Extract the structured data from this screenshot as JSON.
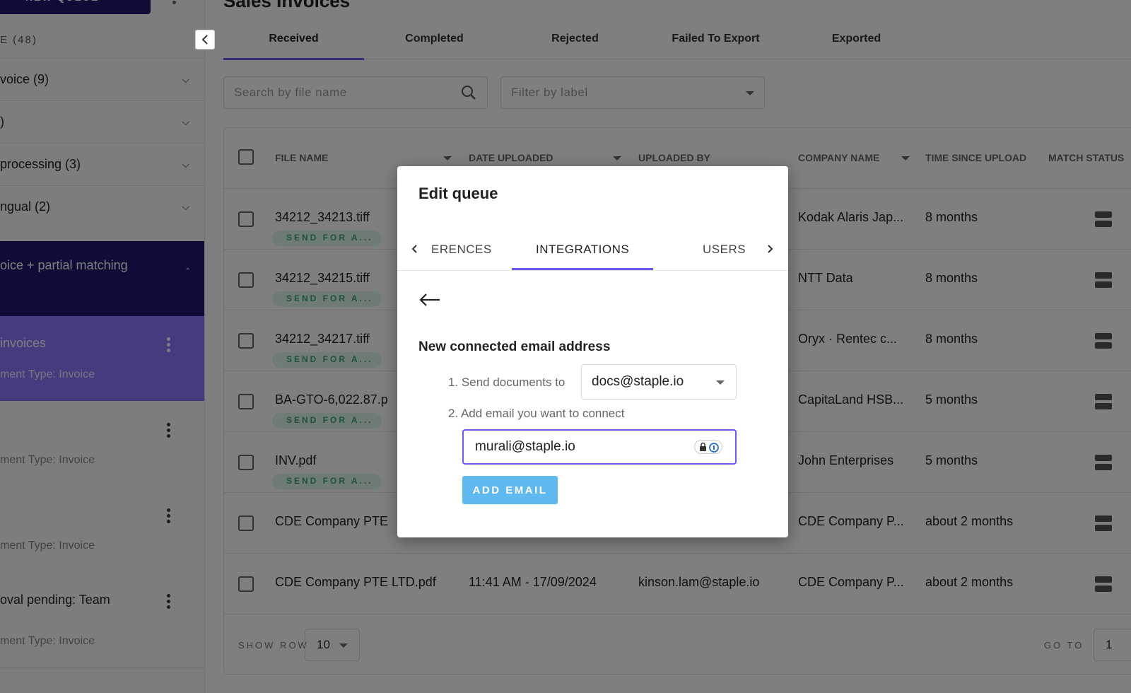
{
  "sidebar": {
    "new_queue_label": "+ NEW QUEUE",
    "queue_count": "E (48)",
    "groups": [
      {
        "label": "voice (9)"
      },
      {
        "label": ")"
      },
      {
        "label": "processing (3)"
      },
      {
        "label": "ngual (2)"
      }
    ],
    "active_group": {
      "label": "oice + partial matching"
    },
    "queues": [
      {
        "title": " invoices",
        "subtitle": "ment Type: Invoice"
      },
      {
        "title": "",
        "subtitle": "ment Type: Invoice"
      },
      {
        "title": "",
        "subtitle": "ment Type: Invoice"
      },
      {
        "title": "oval pending: Team",
        "subtitle": "ment Type: Invoice"
      }
    ]
  },
  "main": {
    "title": "Sales Invoices",
    "tabs": [
      "Received",
      "Completed",
      "Rejected",
      "Failed To Export",
      "Exported"
    ],
    "search_placeholder": "Search by file name",
    "filter_placeholder": "Filter by label",
    "table": {
      "headers": {
        "file_name": "FILE NAME",
        "date_uploaded": "DATE UPLOADED",
        "uploaded_by": "UPLOADED BY",
        "company_name": "COMPANY NAME",
        "time_since_upload": "TIME SINCE UPLOAD",
        "match_status": "MATCH STATUS"
      },
      "rows": [
        {
          "file": "34212_34213.tiff",
          "tag": "SEND FOR A...",
          "date": "",
          "uploader": "",
          "company": "Kodak Alaris Jap...",
          "time": "8 months"
        },
        {
          "file": "34212_34215.tiff",
          "tag": "SEND FOR A...",
          "date": "",
          "uploader": "",
          "company": "NTT Data",
          "time": "8 months"
        },
        {
          "file": "34212_34217.tiff",
          "tag": "SEND FOR A...",
          "date": "",
          "uploader": "",
          "company": "Oryx  ·  Rentec c...",
          "time": "8 months"
        },
        {
          "file": "BA-GTO-6,022.87.p",
          "tag": "SEND FOR A...",
          "date": "",
          "uploader": "",
          "company": "CapitaLand HSB...",
          "time": "5 months"
        },
        {
          "file": "INV.pdf",
          "tag": "SEND FOR A...",
          "date": "",
          "uploader": "",
          "company": "John Enterprises",
          "time": "5 months"
        },
        {
          "file": "CDE Company PTE",
          "tag": "",
          "date": "",
          "uploader": "",
          "company": "CDE Company P...",
          "time": "about 2 months"
        },
        {
          "file": "CDE Company PTE LTD.pdf",
          "tag": "",
          "date": "11:41 AM - 17/09/2024",
          "uploader": "kinson.lam@staple.io",
          "company": "CDE Company P...",
          "time": "about 2 months"
        }
      ]
    },
    "pager": {
      "show_row_label": "SHOW ROW",
      "rows_value": "10",
      "goto_label": "GO TO",
      "goto_value": "1"
    }
  },
  "modal": {
    "title": "Edit queue",
    "tabs": {
      "prev": "ERENCES",
      "active": "INTEGRATIONS",
      "next": "USERS"
    },
    "section_title": "New connected email address",
    "step1_label": "1. Send documents to",
    "send_to_value": "docs@staple.io",
    "step2_label": "2. Add email you want to connect",
    "email_value": "murali@staple.io",
    "add_button": "ADD EMAIL"
  },
  "colors": {
    "accent": "#6b5cf0",
    "navy": "#1e1a6e",
    "selected_queue": "#8a79ff",
    "button_blue": "#5fb8ee",
    "tag_green": "#3aa670"
  }
}
